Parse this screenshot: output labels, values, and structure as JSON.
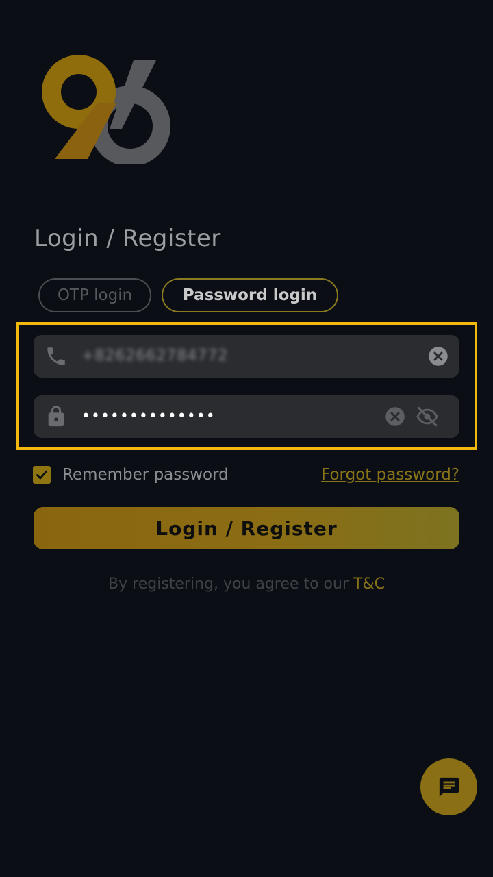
{
  "logo": {
    "text": "96"
  },
  "page": {
    "title": "Login / Register"
  },
  "tabs": [
    {
      "label": "OTP login",
      "active": false
    },
    {
      "label": "Password login",
      "active": true
    }
  ],
  "phone_field": {
    "value": "+8262662784772",
    "icon": "phone-icon"
  },
  "password_field": {
    "value": "••••••••••••••",
    "icon": "lock-icon"
  },
  "remember": {
    "label": "Remember password",
    "checked": true
  },
  "forgot": {
    "label": "Forgot password? "
  },
  "login_button": {
    "label": "Login / Register"
  },
  "terms": {
    "prefix": "By registering, you agree to our ",
    "link": "T&C"
  },
  "chat": {
    "icon": "chat-icon"
  },
  "colors": {
    "accent": "#f4b70e",
    "background": "#0b0f15"
  }
}
